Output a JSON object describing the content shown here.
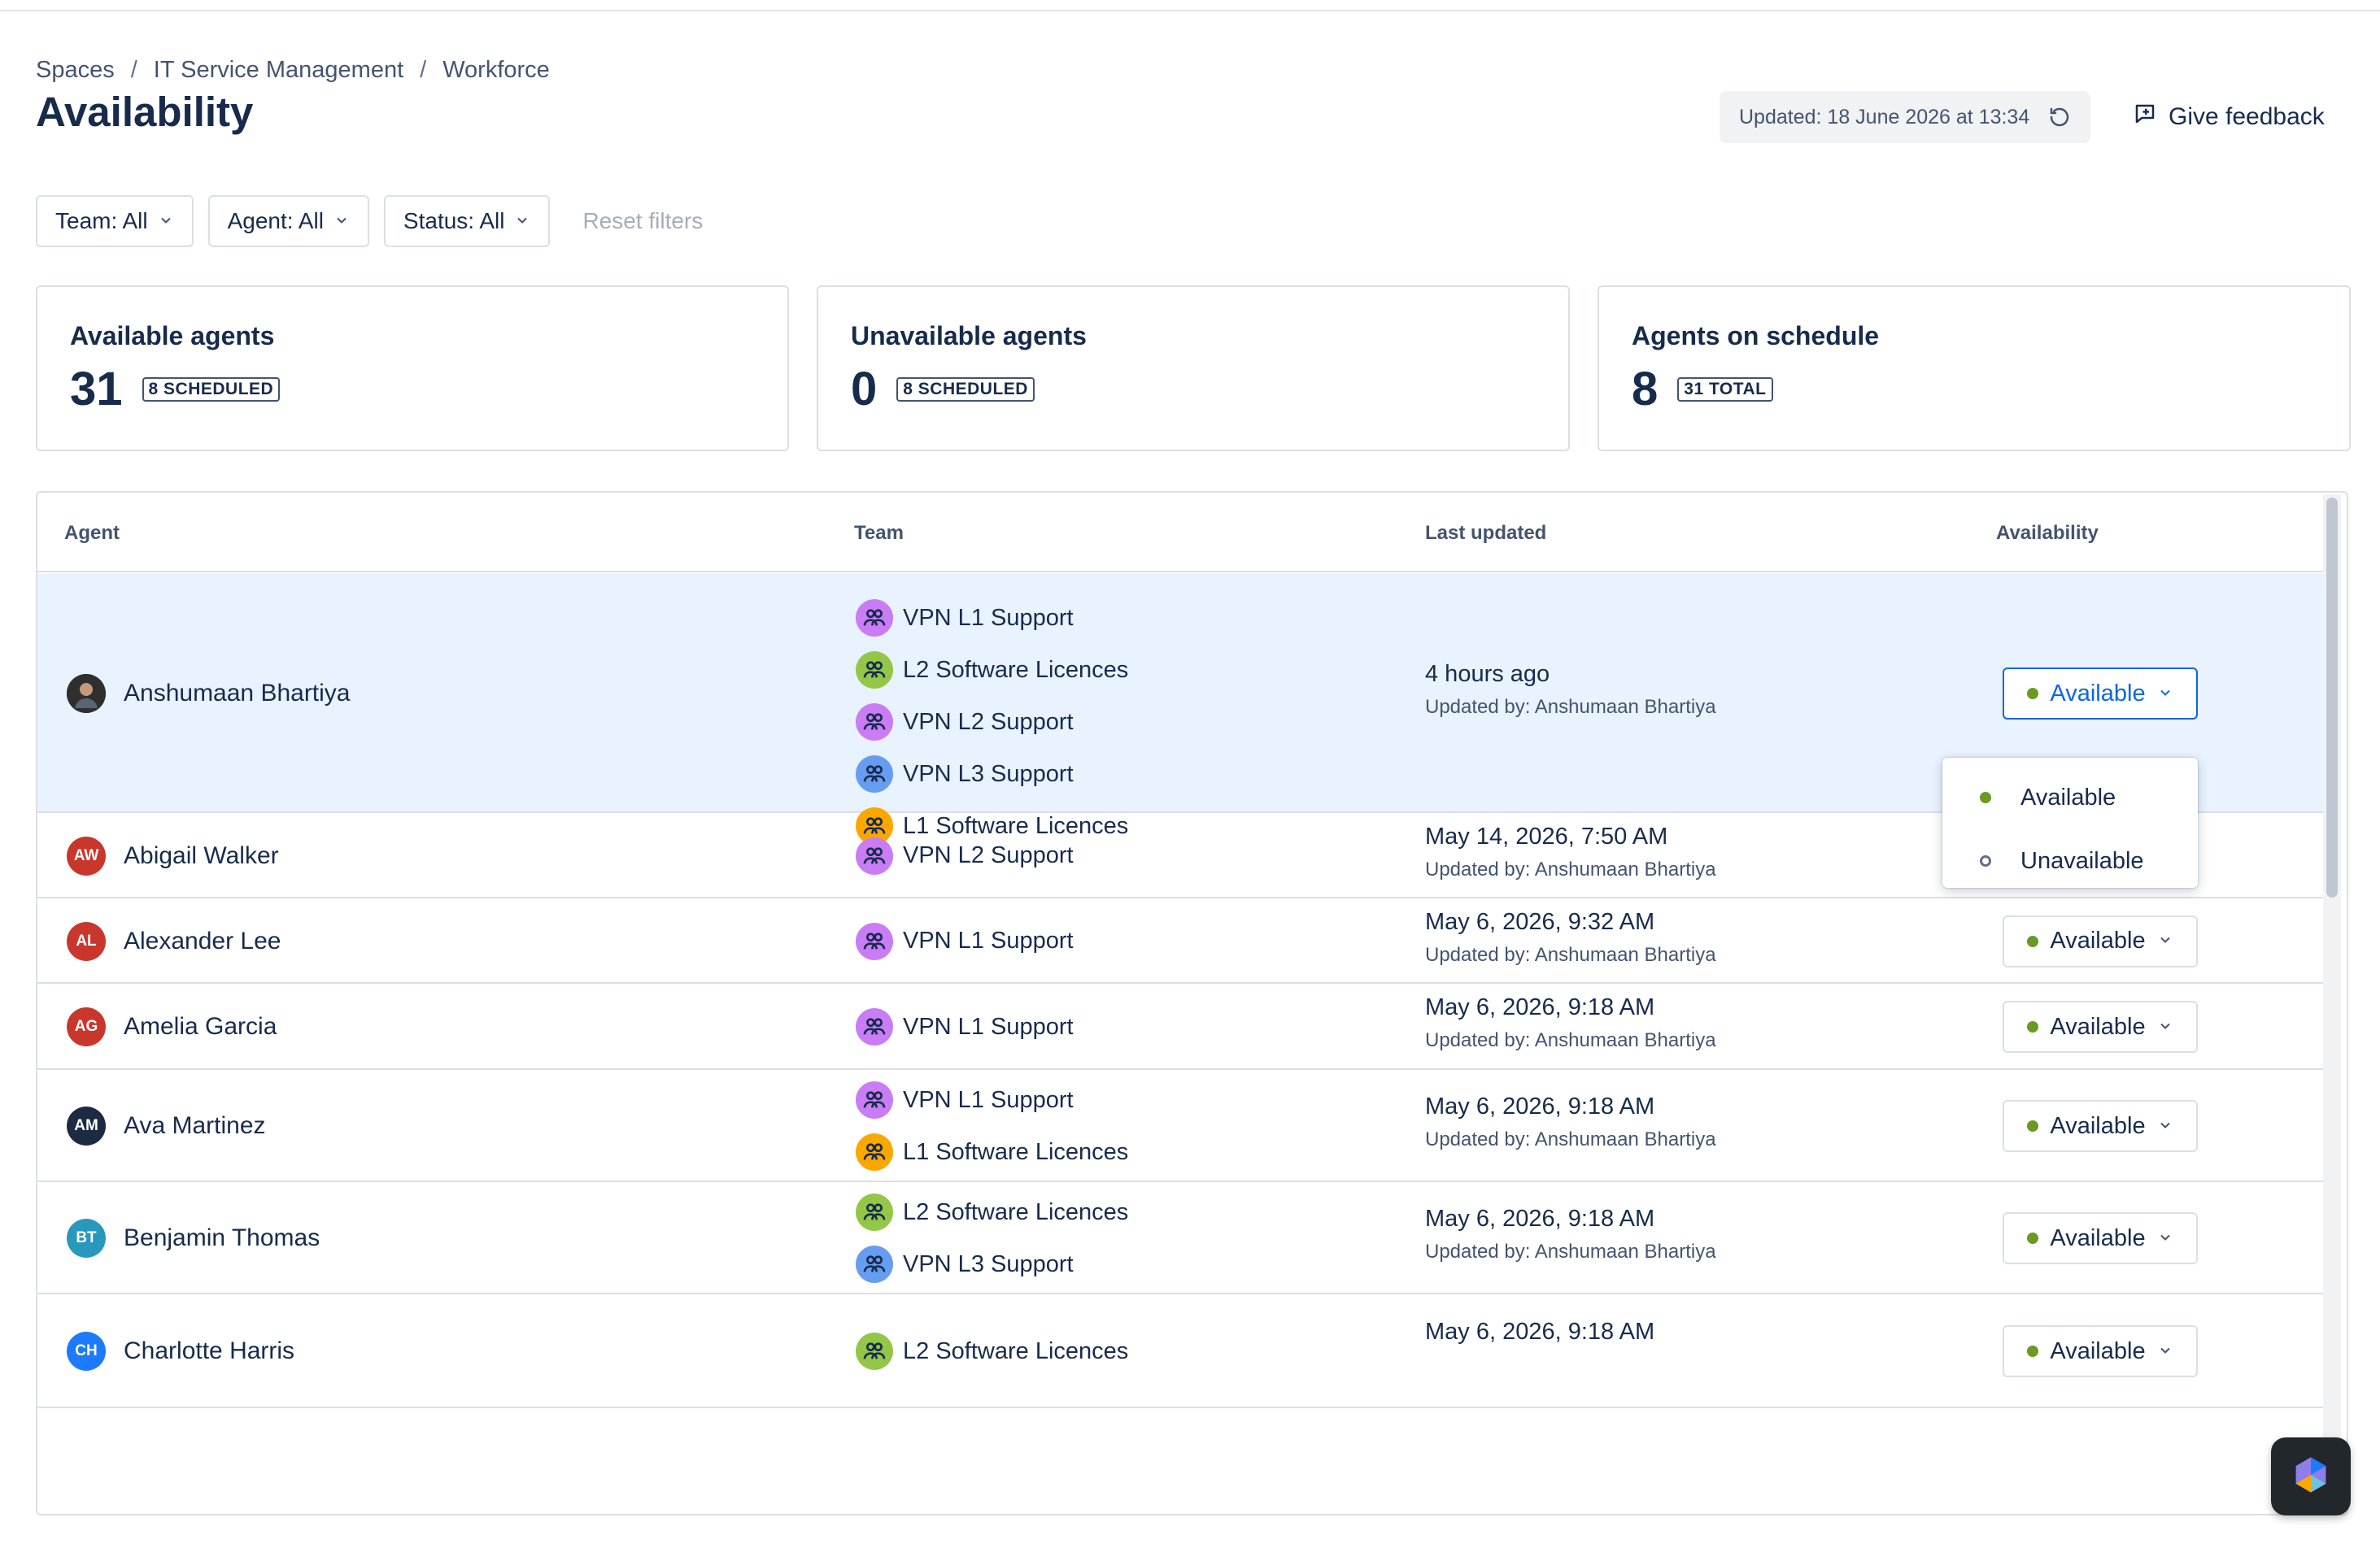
{
  "breadcrumb": {
    "items": [
      "Spaces",
      "IT Service Management",
      "Workforce"
    ],
    "separator": "/"
  },
  "page": {
    "title": "Availability"
  },
  "header": {
    "updated_label": "Updated: 18 June 2026 at 13:34",
    "feedback_label": "Give feedback"
  },
  "filters": {
    "team": "Team: All",
    "agent": "Agent: All",
    "status": "Status: All",
    "reset": "Reset filters"
  },
  "cards": [
    {
      "title": "Available agents",
      "value": "31",
      "badge": "8 SCHEDULED"
    },
    {
      "title": "Unavailable agents",
      "value": "0",
      "badge": "8 SCHEDULED"
    },
    {
      "title": "Agents on schedule",
      "value": "8",
      "badge": "31 TOTAL"
    }
  ],
  "table": {
    "headers": {
      "agent": "Agent",
      "team": "Team",
      "last_updated": "Last updated",
      "availability": "Availability"
    },
    "rows": [
      {
        "name": "Anshumaan Bhartiya",
        "initials": "",
        "avatar_color": "#3b3b3b",
        "teams": [
          "VPN L1 Support",
          "L2 Software Licences",
          "VPN L2 Support",
          "VPN L3 Support",
          "L1 Software Licences"
        ],
        "when": "4 hours ago",
        "by": "Updated by: Anshumaan Bhartiya",
        "status": "Available"
      },
      {
        "name": "Abigail Walker",
        "initials": "AW",
        "avatar_color": "#c9372c",
        "teams": [
          "VPN L2 Support"
        ],
        "when": "May 14, 2026, 7:50 AM",
        "by": "Updated by: Anshumaan Bhartiya",
        "status": "Available"
      },
      {
        "name": "Alexander Lee",
        "initials": "AL",
        "avatar_color": "#c9372c",
        "teams": [
          "VPN L1 Support"
        ],
        "when": "May 6, 2026, 9:32 AM",
        "by": "Updated by: Anshumaan Bhartiya",
        "status": "Available"
      },
      {
        "name": "Amelia Garcia",
        "initials": "AG",
        "avatar_color": "#c9372c",
        "teams": [
          "VPN L1 Support"
        ],
        "when": "May 6, 2026, 9:18 AM",
        "by": "Updated by: Anshumaan Bhartiya",
        "status": "Available"
      },
      {
        "name": "Ava Martinez",
        "initials": "AM",
        "avatar_color": "#1c2b41",
        "teams": [
          "VPN L1 Support",
          "L1 Software Licences"
        ],
        "when": "May 6, 2026, 9:18 AM",
        "by": "Updated by: Anshumaan Bhartiya",
        "status": "Available"
      },
      {
        "name": "Benjamin Thomas",
        "initials": "BT",
        "avatar_color": "#2898bd",
        "teams": [
          "L2 Software Licences",
          "VPN L3 Support"
        ],
        "when": "May 6, 2026, 9:18 AM",
        "by": "Updated by: Anshumaan Bhartiya",
        "status": "Available"
      },
      {
        "name": "Charlotte Harris",
        "initials": "CH",
        "avatar_color": "#1d7afc",
        "teams": [
          "L2 Software Licences"
        ],
        "when": "May 6, 2026, 9:18 AM",
        "by": "",
        "status": "Available"
      }
    ]
  },
  "dropdown": {
    "options": [
      "Available",
      "Unavailable"
    ]
  },
  "colors": {
    "available_dot": "#6a9a23",
    "selected_row": "#e9f2ff",
    "accent": "#0c66e4"
  },
  "team_colors": {
    "VPN L1 Support": "#c97cf4",
    "VPN L2 Support": "#c97cf4",
    "VPN L3 Support": "#669df1",
    "L1 Software Licences": "#fca700",
    "L2 Software Licences": "#94c748"
  }
}
